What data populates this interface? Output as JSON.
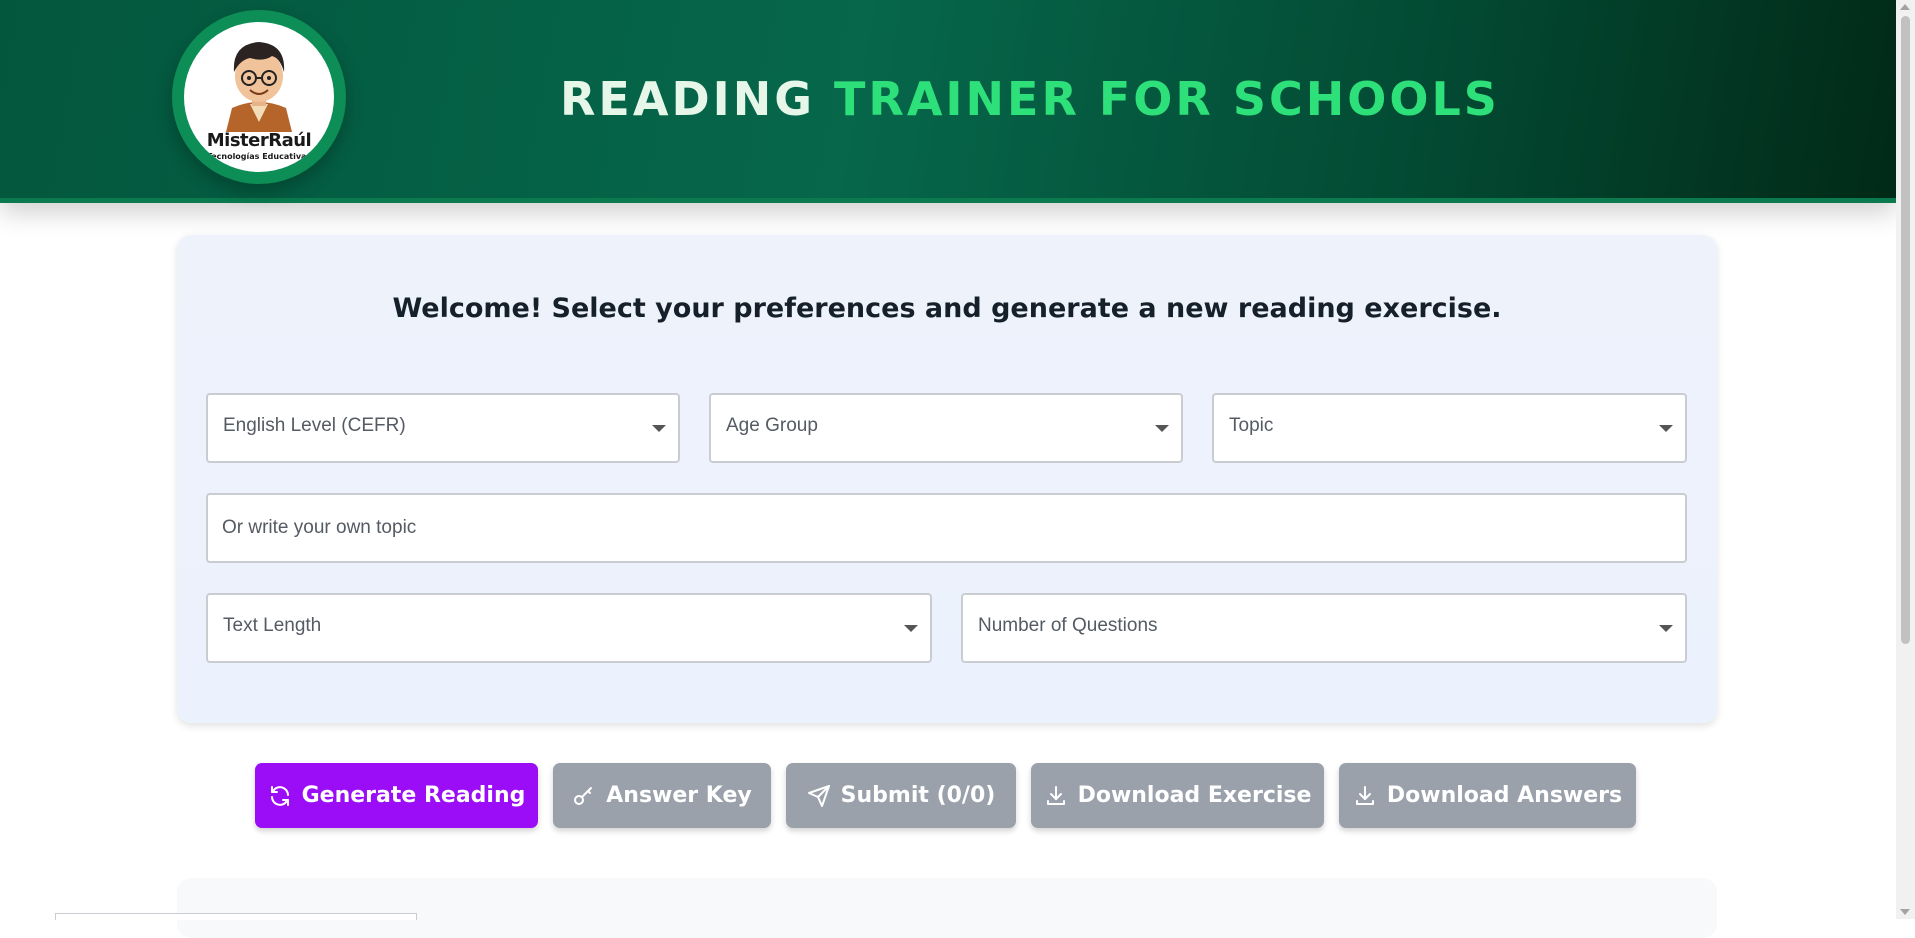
{
  "header": {
    "title_part1": "READING",
    "title_part2": "TRAINER FOR SCHOOLS",
    "logo_name": "MisterRaúl",
    "logo_subtitle": "Tecnologías Educativas"
  },
  "panel": {
    "welcome": "Welcome! Select your preferences and generate a new reading exercise.",
    "english_level": "English Level (CEFR)",
    "age_group": "Age Group",
    "topic": "Topic",
    "own_topic_placeholder": "Or write your own topic",
    "text_length": "Text Length",
    "num_questions": "Number of Questions"
  },
  "buttons": {
    "generate": "Generate Reading",
    "answer_key": "Answer Key",
    "submit": "Submit (0/0)",
    "download_exercise": "Download Exercise",
    "download_answers": "Download Answers"
  },
  "colors": {
    "header_green": "#03573d",
    "title_accent": "#2ee07a",
    "primary_button": "#9b0df7",
    "muted_button": "#9ba1ab"
  },
  "icons": {
    "generate": "refresh-icon",
    "answer_key": "key-icon",
    "submit": "send-icon",
    "download": "download-icon"
  }
}
